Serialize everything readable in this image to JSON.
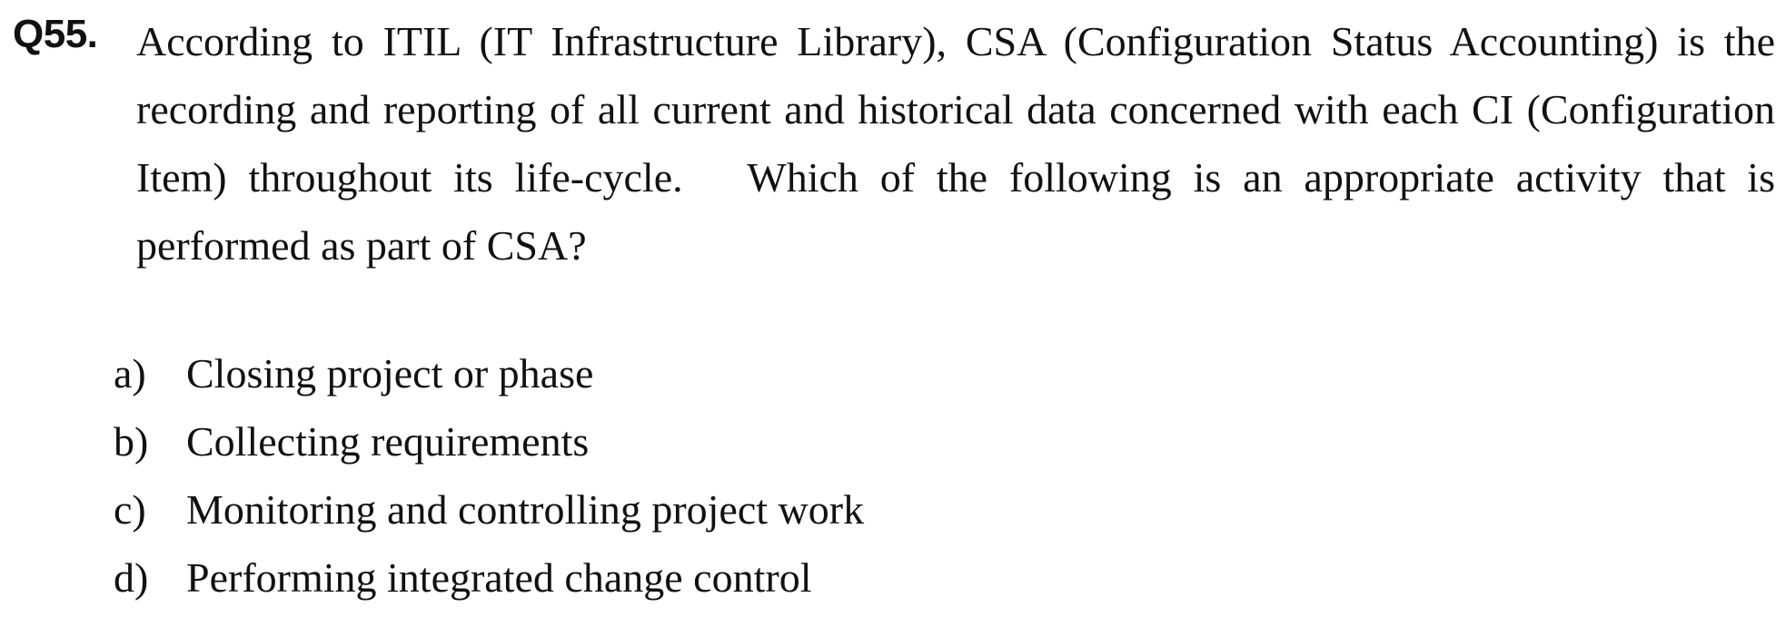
{
  "question": {
    "number": "Q55.",
    "stem": "According to ITIL (IT Infrastructure Library), CSA (Configuration Status Accounting) is the recording and reporting of all current and historical data concerned with each CI (Configuration Item) throughout its life-cycle.   Which of the following is an appropriate activity that is performed as part of CSA?",
    "options": [
      {
        "letter": "a)",
        "text": "Closing project or phase"
      },
      {
        "letter": "b)",
        "text": "Collecting requirements"
      },
      {
        "letter": "c)",
        "text": "Monitoring and controlling project work"
      },
      {
        "letter": "d)",
        "text": "Performing integrated change control"
      }
    ]
  }
}
